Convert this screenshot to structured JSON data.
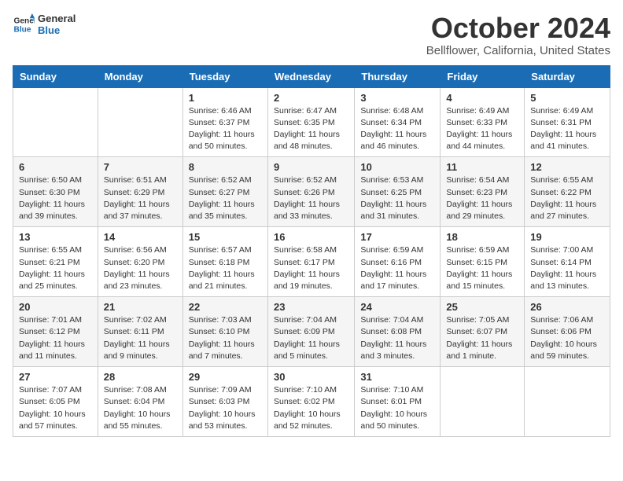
{
  "header": {
    "logo_line1": "General",
    "logo_line2": "Blue",
    "month": "October 2024",
    "location": "Bellflower, California, United States"
  },
  "weekdays": [
    "Sunday",
    "Monday",
    "Tuesday",
    "Wednesday",
    "Thursday",
    "Friday",
    "Saturday"
  ],
  "weeks": [
    [
      {
        "day": "",
        "info": ""
      },
      {
        "day": "",
        "info": ""
      },
      {
        "day": "1",
        "info": "Sunrise: 6:46 AM\nSunset: 6:37 PM\nDaylight: 11 hours and 50 minutes."
      },
      {
        "day": "2",
        "info": "Sunrise: 6:47 AM\nSunset: 6:35 PM\nDaylight: 11 hours and 48 minutes."
      },
      {
        "day": "3",
        "info": "Sunrise: 6:48 AM\nSunset: 6:34 PM\nDaylight: 11 hours and 46 minutes."
      },
      {
        "day": "4",
        "info": "Sunrise: 6:49 AM\nSunset: 6:33 PM\nDaylight: 11 hours and 44 minutes."
      },
      {
        "day": "5",
        "info": "Sunrise: 6:49 AM\nSunset: 6:31 PM\nDaylight: 11 hours and 41 minutes."
      }
    ],
    [
      {
        "day": "6",
        "info": "Sunrise: 6:50 AM\nSunset: 6:30 PM\nDaylight: 11 hours and 39 minutes."
      },
      {
        "day": "7",
        "info": "Sunrise: 6:51 AM\nSunset: 6:29 PM\nDaylight: 11 hours and 37 minutes."
      },
      {
        "day": "8",
        "info": "Sunrise: 6:52 AM\nSunset: 6:27 PM\nDaylight: 11 hours and 35 minutes."
      },
      {
        "day": "9",
        "info": "Sunrise: 6:52 AM\nSunset: 6:26 PM\nDaylight: 11 hours and 33 minutes."
      },
      {
        "day": "10",
        "info": "Sunrise: 6:53 AM\nSunset: 6:25 PM\nDaylight: 11 hours and 31 minutes."
      },
      {
        "day": "11",
        "info": "Sunrise: 6:54 AM\nSunset: 6:23 PM\nDaylight: 11 hours and 29 minutes."
      },
      {
        "day": "12",
        "info": "Sunrise: 6:55 AM\nSunset: 6:22 PM\nDaylight: 11 hours and 27 minutes."
      }
    ],
    [
      {
        "day": "13",
        "info": "Sunrise: 6:55 AM\nSunset: 6:21 PM\nDaylight: 11 hours and 25 minutes."
      },
      {
        "day": "14",
        "info": "Sunrise: 6:56 AM\nSunset: 6:20 PM\nDaylight: 11 hours and 23 minutes."
      },
      {
        "day": "15",
        "info": "Sunrise: 6:57 AM\nSunset: 6:18 PM\nDaylight: 11 hours and 21 minutes."
      },
      {
        "day": "16",
        "info": "Sunrise: 6:58 AM\nSunset: 6:17 PM\nDaylight: 11 hours and 19 minutes."
      },
      {
        "day": "17",
        "info": "Sunrise: 6:59 AM\nSunset: 6:16 PM\nDaylight: 11 hours and 17 minutes."
      },
      {
        "day": "18",
        "info": "Sunrise: 6:59 AM\nSunset: 6:15 PM\nDaylight: 11 hours and 15 minutes."
      },
      {
        "day": "19",
        "info": "Sunrise: 7:00 AM\nSunset: 6:14 PM\nDaylight: 11 hours and 13 minutes."
      }
    ],
    [
      {
        "day": "20",
        "info": "Sunrise: 7:01 AM\nSunset: 6:12 PM\nDaylight: 11 hours and 11 minutes."
      },
      {
        "day": "21",
        "info": "Sunrise: 7:02 AM\nSunset: 6:11 PM\nDaylight: 11 hours and 9 minutes."
      },
      {
        "day": "22",
        "info": "Sunrise: 7:03 AM\nSunset: 6:10 PM\nDaylight: 11 hours and 7 minutes."
      },
      {
        "day": "23",
        "info": "Sunrise: 7:04 AM\nSunset: 6:09 PM\nDaylight: 11 hours and 5 minutes."
      },
      {
        "day": "24",
        "info": "Sunrise: 7:04 AM\nSunset: 6:08 PM\nDaylight: 11 hours and 3 minutes."
      },
      {
        "day": "25",
        "info": "Sunrise: 7:05 AM\nSunset: 6:07 PM\nDaylight: 11 hours and 1 minute."
      },
      {
        "day": "26",
        "info": "Sunrise: 7:06 AM\nSunset: 6:06 PM\nDaylight: 10 hours and 59 minutes."
      }
    ],
    [
      {
        "day": "27",
        "info": "Sunrise: 7:07 AM\nSunset: 6:05 PM\nDaylight: 10 hours and 57 minutes."
      },
      {
        "day": "28",
        "info": "Sunrise: 7:08 AM\nSunset: 6:04 PM\nDaylight: 10 hours and 55 minutes."
      },
      {
        "day": "29",
        "info": "Sunrise: 7:09 AM\nSunset: 6:03 PM\nDaylight: 10 hours and 53 minutes."
      },
      {
        "day": "30",
        "info": "Sunrise: 7:10 AM\nSunset: 6:02 PM\nDaylight: 10 hours and 52 minutes."
      },
      {
        "day": "31",
        "info": "Sunrise: 7:10 AM\nSunset: 6:01 PM\nDaylight: 10 hours and 50 minutes."
      },
      {
        "day": "",
        "info": ""
      },
      {
        "day": "",
        "info": ""
      }
    ]
  ]
}
